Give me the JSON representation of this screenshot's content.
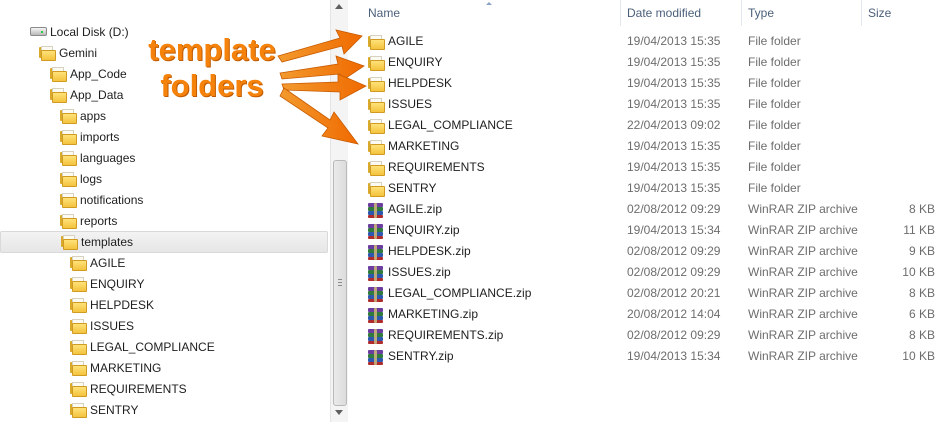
{
  "tree": {
    "items": [
      {
        "label": "Local Disk (D:)",
        "icon": "drive-icon",
        "depth": 0
      },
      {
        "label": "Gemini",
        "icon": "folder-icon",
        "depth": 1
      },
      {
        "label": "App_Code",
        "icon": "folder-icon",
        "depth": 2
      },
      {
        "label": "App_Data",
        "icon": "folder-icon",
        "depth": 2
      },
      {
        "label": "apps",
        "icon": "folder-icon",
        "depth": 3
      },
      {
        "label": "imports",
        "icon": "folder-icon",
        "depth": 3
      },
      {
        "label": "languages",
        "icon": "folder-icon",
        "depth": 3
      },
      {
        "label": "logs",
        "icon": "folder-icon",
        "depth": 3
      },
      {
        "label": "notifications",
        "icon": "folder-icon",
        "depth": 3
      },
      {
        "label": "reports",
        "icon": "folder-icon",
        "depth": 3
      },
      {
        "label": "templates",
        "icon": "folder-icon",
        "depth": 3,
        "selected": true
      },
      {
        "label": "AGILE",
        "icon": "folder-icon",
        "depth": 4
      },
      {
        "label": "ENQUIRY",
        "icon": "folder-icon",
        "depth": 4
      },
      {
        "label": "HELPDESK",
        "icon": "folder-icon",
        "depth": 4
      },
      {
        "label": "ISSUES",
        "icon": "folder-icon",
        "depth": 4
      },
      {
        "label": "LEGAL_COMPLIANCE",
        "icon": "folder-icon",
        "depth": 4
      },
      {
        "label": "MARKETING",
        "icon": "folder-icon",
        "depth": 4
      },
      {
        "label": "REQUIREMENTS",
        "icon": "folder-icon",
        "depth": 4
      },
      {
        "label": "SENTRY",
        "icon": "folder-icon",
        "depth": 4
      }
    ]
  },
  "list": {
    "columns": {
      "name": "Name",
      "date": "Date modified",
      "type": "Type",
      "size": "Size"
    },
    "rows": [
      {
        "name": "AGILE",
        "date": "19/04/2013 15:35",
        "type": "File folder",
        "size": "",
        "icon": "folder-icon"
      },
      {
        "name": "ENQUIRY",
        "date": "19/04/2013 15:35",
        "type": "File folder",
        "size": "",
        "icon": "folder-icon"
      },
      {
        "name": "HELPDESK",
        "date": "19/04/2013 15:35",
        "type": "File folder",
        "size": "",
        "icon": "folder-icon"
      },
      {
        "name": "ISSUES",
        "date": "19/04/2013 15:35",
        "type": "File folder",
        "size": "",
        "icon": "folder-icon"
      },
      {
        "name": "LEGAL_COMPLIANCE",
        "date": "22/04/2013 09:02",
        "type": "File folder",
        "size": "",
        "icon": "folder-icon"
      },
      {
        "name": "MARKETING",
        "date": "19/04/2013 15:35",
        "type": "File folder",
        "size": "",
        "icon": "folder-icon"
      },
      {
        "name": "REQUIREMENTS",
        "date": "19/04/2013 15:35",
        "type": "File folder",
        "size": "",
        "icon": "folder-icon"
      },
      {
        "name": "SENTRY",
        "date": "19/04/2013 15:35",
        "type": "File folder",
        "size": "",
        "icon": "folder-icon"
      },
      {
        "name": "AGILE.zip",
        "date": "02/08/2012 09:29",
        "type": "WinRAR ZIP archive",
        "size": "8 KB",
        "icon": "winrar-zip-icon"
      },
      {
        "name": "ENQUIRY.zip",
        "date": "19/04/2013 15:34",
        "type": "WinRAR ZIP archive",
        "size": "11 KB",
        "icon": "winrar-zip-icon"
      },
      {
        "name": "HELPDESK.zip",
        "date": "02/08/2012 09:29",
        "type": "WinRAR ZIP archive",
        "size": "9 KB",
        "icon": "winrar-zip-icon"
      },
      {
        "name": "ISSUES.zip",
        "date": "02/08/2012 09:29",
        "type": "WinRAR ZIP archive",
        "size": "10 KB",
        "icon": "winrar-zip-icon"
      },
      {
        "name": "LEGAL_COMPLIANCE.zip",
        "date": "02/08/2012 20:21",
        "type": "WinRAR ZIP archive",
        "size": "8 KB",
        "icon": "winrar-zip-icon"
      },
      {
        "name": "MARKETING.zip",
        "date": "20/08/2012 14:04",
        "type": "WinRAR ZIP archive",
        "size": "6 KB",
        "icon": "winrar-zip-icon"
      },
      {
        "name": "REQUIREMENTS.zip",
        "date": "02/08/2012 09:29",
        "type": "WinRAR ZIP archive",
        "size": "8 KB",
        "icon": "winrar-zip-icon"
      },
      {
        "name": "SENTRY.zip",
        "date": "19/04/2013 15:34",
        "type": "WinRAR ZIP archive",
        "size": "10 KB",
        "icon": "winrar-zip-icon"
      }
    ]
  },
  "annotation": {
    "line1": "template",
    "line2": "folders",
    "color": "#f5820a"
  }
}
